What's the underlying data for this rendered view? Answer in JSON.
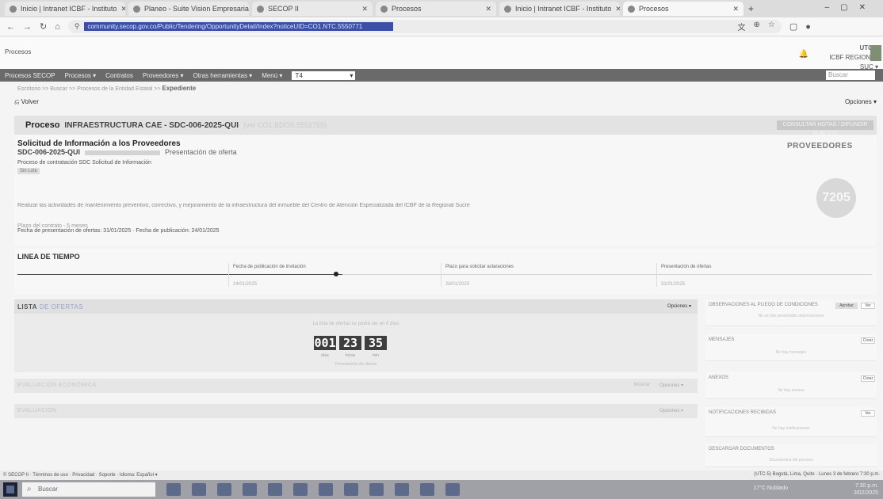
{
  "browser": {
    "tabs": [
      {
        "label": "Inicio | Intranet ICBF - Instituto",
        "active": false
      },
      {
        "label": "Planeo - Suite Vision Empresarial",
        "active": false
      },
      {
        "label": "SECOP II",
        "active": false
      },
      {
        "label": "Procesos",
        "active": false
      },
      {
        "label": "Inicio | Intranet ICBF - Instituto",
        "active": false
      },
      {
        "label": "Procesos",
        "active": true
      }
    ],
    "url": "community.secop.gov.co/Public/Tendering/OpportunityDetail/Index?noticeUID=CO1.NTC.5550771"
  },
  "header": {
    "brand": "Procesos",
    "user_name": "UTC-5",
    "user_org": "ICBF REGIONAL SUCRE",
    "user_menu": "ICBF REGIONAL SUC ▾"
  },
  "menu": {
    "items": [
      "Procesos SECOP",
      "Procesos ▾",
      "Contratos",
      "Proveedores ▾",
      "Otras herramientas ▾",
      "Menú ▾"
    ],
    "select_value": "T4",
    "search_placeholder": "Buscar"
  },
  "breadcrumb": {
    "path": "Escritorio >> Buscar >> Procesos de la Entidad Estatal >> ",
    "current": "Expediente"
  },
  "actions": {
    "back": "Volver",
    "options": "Opciones ▾"
  },
  "process": {
    "label": "Proceso",
    "name": "INFRAESTRUCTURA CAE - SDC-006-2025-QUI",
    "extra": "(ver CO1.BDOS.5552755)",
    "button": "CONSULTAR NOTAS / DIFUNDIR PUBLICO"
  },
  "details": {
    "title": "Solicitud de Información a los Proveedores",
    "code": "SDC-006-2025-QUI",
    "state": "Presentación de oferta",
    "type": "Proceso de contratación SDC Solicitud de Información",
    "tag": "Sin Lote",
    "description": "Realizar las actividades de mantenimiento preventivo, correctivo, y mejoramiento de la infraestructura del inmueble del Centro de Atención Especializada del ICBF de la Regional Sucre",
    "dates_line1": "Plazo del contrato - 5 meses",
    "dates_line2": "Fecha de presentación de ofertas: 31/01/2025 · Fecha de publicación: 24/01/2025",
    "providers_label": "PROVEEDORES",
    "providers_count": "7205"
  },
  "timeline": {
    "title": "LINEA DE TIEMPO",
    "columns": [
      {
        "label": "Fecha de publicación de invitación",
        "value": "24/01/2025"
      },
      {
        "label": "Plazo para solicitar aclaraciones",
        "value": "28/01/2025"
      },
      {
        "label": "Presentación de ofertas",
        "value": "31/01/2025"
      }
    ]
  },
  "offers": {
    "title": "LISTA",
    "title_rest": " DE OFERTAS",
    "options": "Opciones ▾",
    "note": "La lista de ofertas se podrá ver en 6 días",
    "countdown": {
      "days": "001",
      "hours": "23",
      "minutes": "35"
    },
    "units": {
      "days": "días",
      "hours": "horas",
      "minutes": "min"
    },
    "foot": "Presentación de ofertas"
  },
  "evaluations": [
    {
      "title": "EVALUACIÓN ECONÓMICA",
      "mid": "Mostrar",
      "right": "Opciones ▾"
    },
    {
      "title": "EVALUACIÓN",
      "mid": "",
      "right": "Opciones ▾"
    }
  ],
  "sidebar": [
    {
      "title": "OBSERVACIONES AL PLIEGO DE CONDICIONES",
      "sub": "No se han presentado observaciones",
      "btn2": "Aprobar",
      "btn": "Ver"
    },
    {
      "title": "MENSAJES",
      "sub": "No hay mensajes",
      "btn2": "",
      "btn": "Crear"
    },
    {
      "title": "ANEXOS",
      "sub": "No hay anexos",
      "btn2": "",
      "btn": "Crear"
    },
    {
      "title": "NOTIFICACIONES RECIBIDAS",
      "sub": "No hay notificaciones",
      "btn2": "",
      "btn": "Ver"
    },
    {
      "title": "DESCARGAR DOCUMENTOS",
      "sub": "Documentos del proceso",
      "btn2": "",
      "btn": ""
    }
  ],
  "footer": {
    "left": "© SECOP II · Términos de uso · Privacidad · Soporte · Idioma: Español ▾",
    "right": "(UTC-5) Bogotá, Lima, Quito · Lunes 3 de febrero 7:30 p.m."
  },
  "taskbar": {
    "search": "Buscar",
    "weather": "17°C Nublado",
    "clock_time": "7:30 p.m.",
    "clock_date": "3/02/2025"
  }
}
